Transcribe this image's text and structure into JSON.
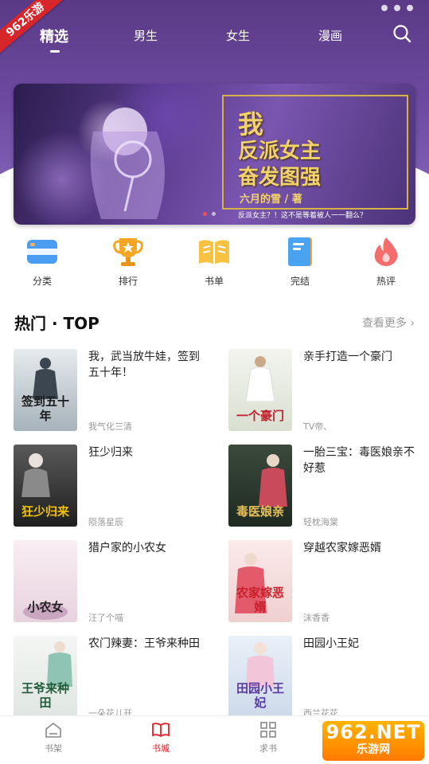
{
  "corner_badge": "962乐游",
  "tabs": [
    {
      "label": "精选",
      "active": true
    },
    {
      "label": "男生",
      "active": false
    },
    {
      "label": "女生",
      "active": false
    },
    {
      "label": "漫画",
      "active": false
    }
  ],
  "banner": {
    "title_line1": "我",
    "title_line2": "反派女主",
    "title_line3": "奋发图强",
    "author": "六月的雪 / 著",
    "slogan": "反派女主？！这不是等着被人一一翻么？",
    "page_count": 2,
    "active_page": 1
  },
  "categories": [
    {
      "label": "分类",
      "icon": "category-icon",
      "color": "#4a9df0"
    },
    {
      "label": "排行",
      "icon": "trophy-icon",
      "color": "#f5a623"
    },
    {
      "label": "书单",
      "icon": "booklist-icon",
      "color": "#f7c142"
    },
    {
      "label": "完结",
      "icon": "finished-book-icon",
      "color": "#4aa3f0"
    },
    {
      "label": "热评",
      "icon": "flame-icon",
      "color": "#f56c6c"
    }
  ],
  "section": {
    "title": "热门 · TOP",
    "more": "查看更多 ›"
  },
  "books": [
    {
      "title": "我，武当放牛娃，签到五十年！",
      "author": "我气化三清",
      "cover_text": "签到五十年",
      "cover_bg": "#cfd6dc",
      "cover_fg": "#1a1a1a"
    },
    {
      "title": "亲手打造一个豪门",
      "author": "TV帝、",
      "cover_text": "一个豪门",
      "cover_bg": "#e8ece2",
      "cover_fg": "#c0202a"
    },
    {
      "title": "狂少归来",
      "author": "陨落星辰",
      "cover_text": "狂少归来",
      "cover_bg": "#3a3a3a",
      "cover_fg": "#f2c200"
    },
    {
      "title": "一胎三宝：毒医娘亲不好惹",
      "author": "轻枕海棠",
      "cover_text": "毒医娘亲",
      "cover_bg": "#2e3a2e",
      "cover_fg": "#e8c15a"
    },
    {
      "title": "猎户家的小农女",
      "author": "汪了个喵",
      "cover_text": "小农女",
      "cover_bg": "#f4e6ee",
      "cover_fg": "#222"
    },
    {
      "title": "穿越农家嫁恶婿",
      "author": "沫香香",
      "cover_text": "农家嫁恶婿",
      "cover_bg": "#f6e3e3",
      "cover_fg": "#c8202a"
    },
    {
      "title": "农门辣妻：王爷来种田",
      "author": "一朵花儿开",
      "cover_text": "王爷来种田",
      "cover_bg": "#eef1ef",
      "cover_fg": "#1f5b3a"
    },
    {
      "title": "田园小王妃",
      "author": "西兰花花",
      "cover_text": "田园小王妃",
      "cover_bg": "#e4ecf6",
      "cover_fg": "#5a3aa0"
    }
  ],
  "bottom_nav": [
    {
      "label": "书架",
      "icon": "bookshelf-icon",
      "active": false
    },
    {
      "label": "书城",
      "icon": "book-store-icon",
      "active": true
    },
    {
      "label": "求书",
      "icon": "request-book-icon",
      "active": false
    }
  ],
  "watermark": {
    "line1": "962.NET",
    "line2": "乐游网"
  },
  "colors": {
    "accent": "#e0202a",
    "header_purple": "#5a3a86"
  }
}
